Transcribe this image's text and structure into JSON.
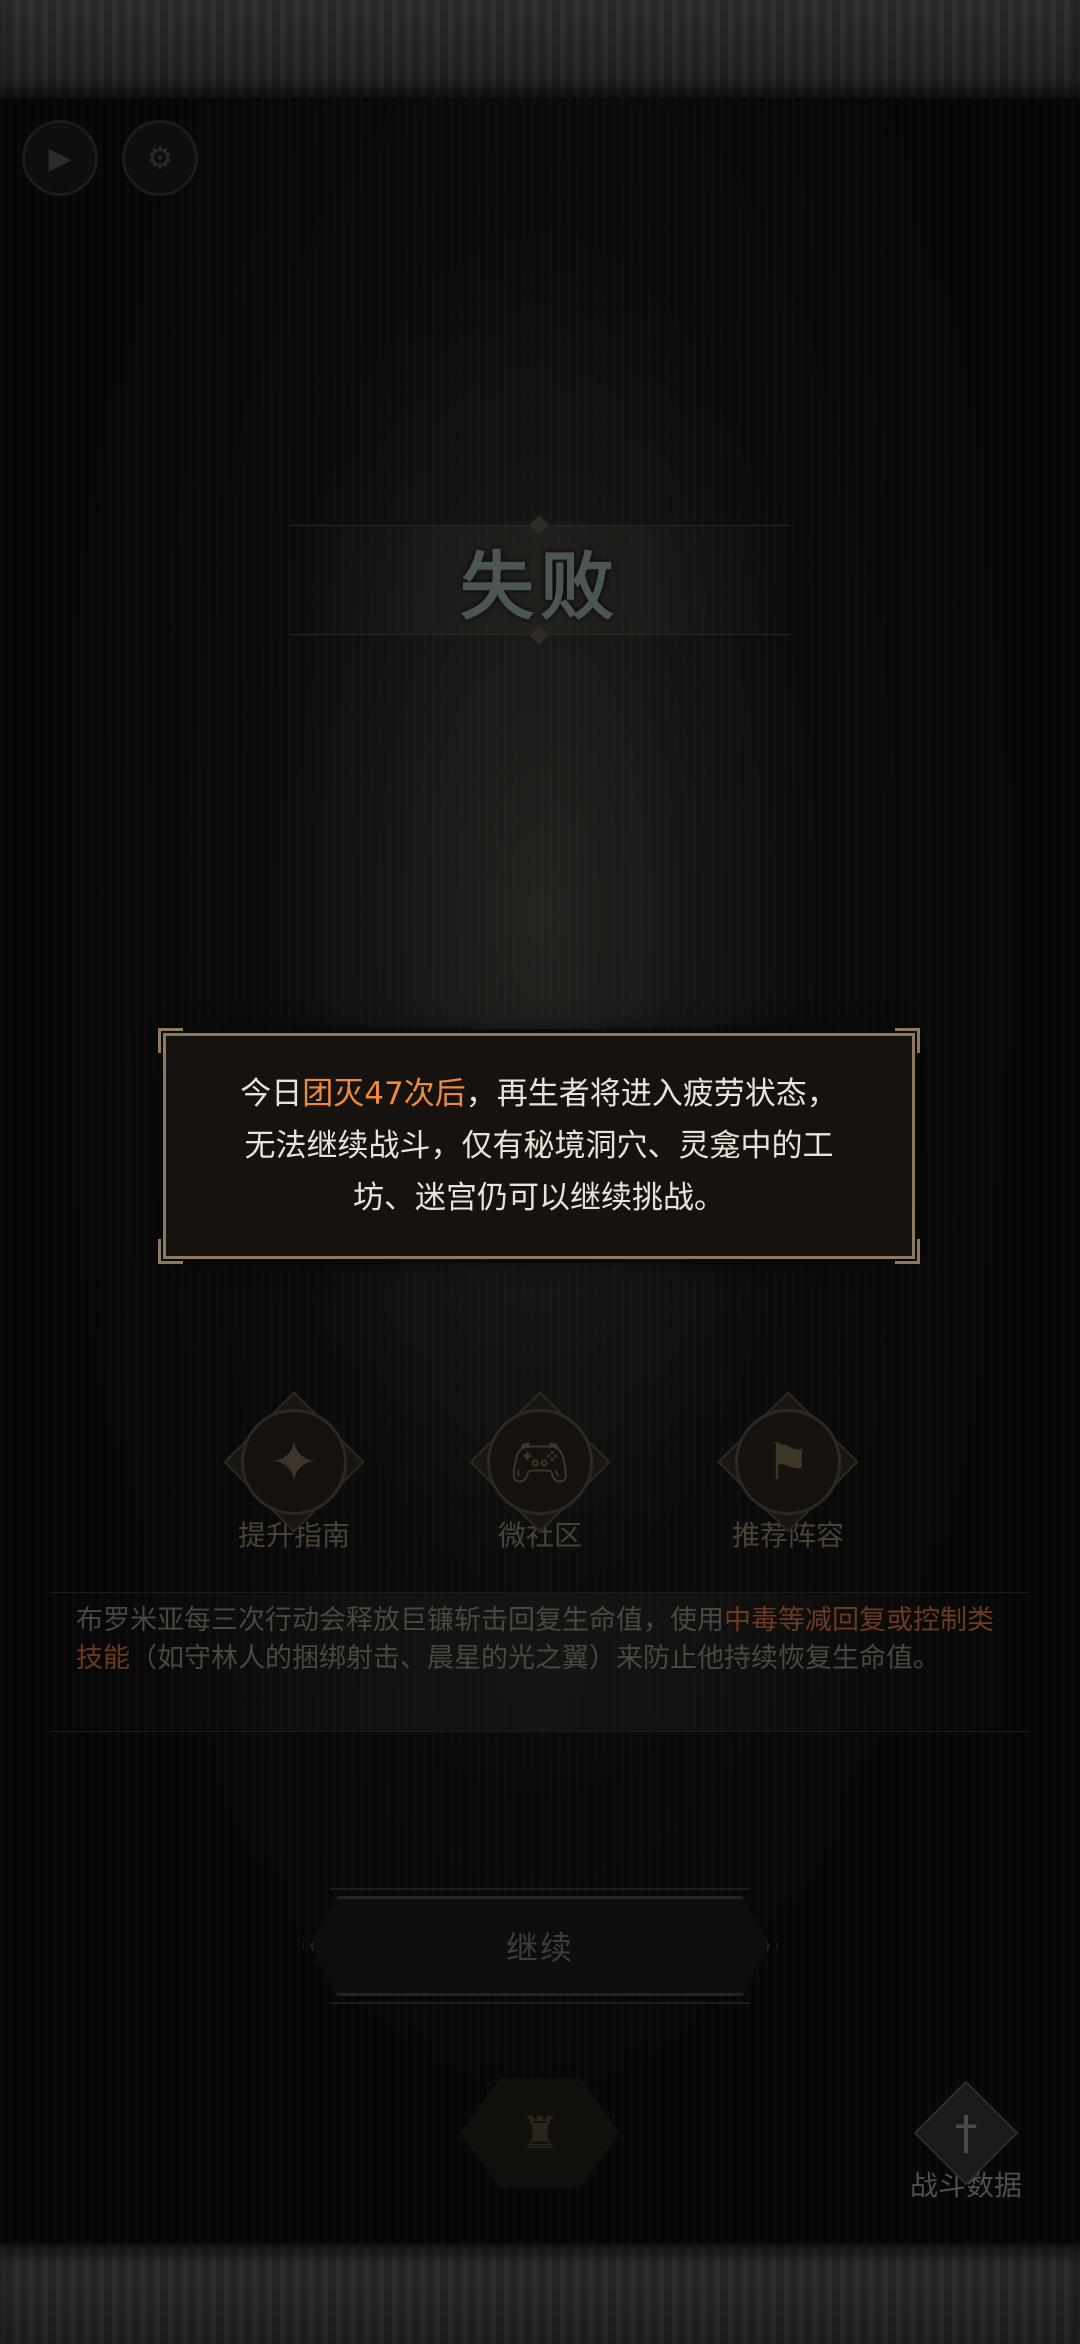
{
  "result": {
    "title": "失败"
  },
  "notice": {
    "prefix": "今日",
    "highlight": "团灭47次后",
    "suffix": "，再生者将进入疲劳状态，无法继续战斗，仅有秘境洞穴、灵龛中的工坊、迷宫仍可以继续挑战。"
  },
  "shortcuts": [
    {
      "label": "提升指南",
      "icon": "compass-icon"
    },
    {
      "label": "微社区",
      "icon": "gamepad-icon"
    },
    {
      "label": "推荐阵容",
      "icon": "thumbs-up-banner-icon"
    }
  ],
  "tip": {
    "part1": "布罗米亚每三次行动会释放巨镰斩击回复生命值，使用",
    "highlight": "中毒等减回复或控制类技能",
    "part2": "（如守林人的捆绑射击、晨星的光之翼）来防止他持续恢复生命值。"
  },
  "buttons": {
    "continue": "继续"
  },
  "battle_data": {
    "label": "战斗数据",
    "icon": "sword-shield-icon"
  },
  "colors": {
    "accent": "#f08a3a",
    "frame": "#8b7a60"
  }
}
